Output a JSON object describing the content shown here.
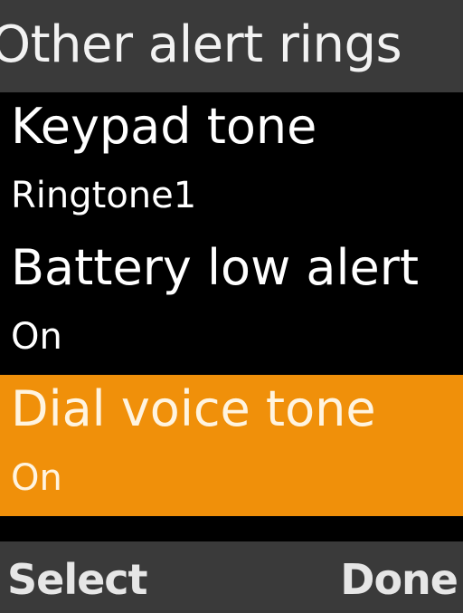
{
  "header": {
    "title": "Other alert rings"
  },
  "items": [
    {
      "label": "Keypad tone",
      "value": "Ringtone1",
      "selected": false
    },
    {
      "label": "Battery low alert",
      "value": "On",
      "selected": false
    },
    {
      "label": "Dial voice tone",
      "value": "On",
      "selected": true
    }
  ],
  "softkeys": {
    "left": "Select",
    "right": "Done"
  },
  "colors": {
    "background": "#000000",
    "bar": "#3a3a3a",
    "highlight": "#f0900a"
  }
}
